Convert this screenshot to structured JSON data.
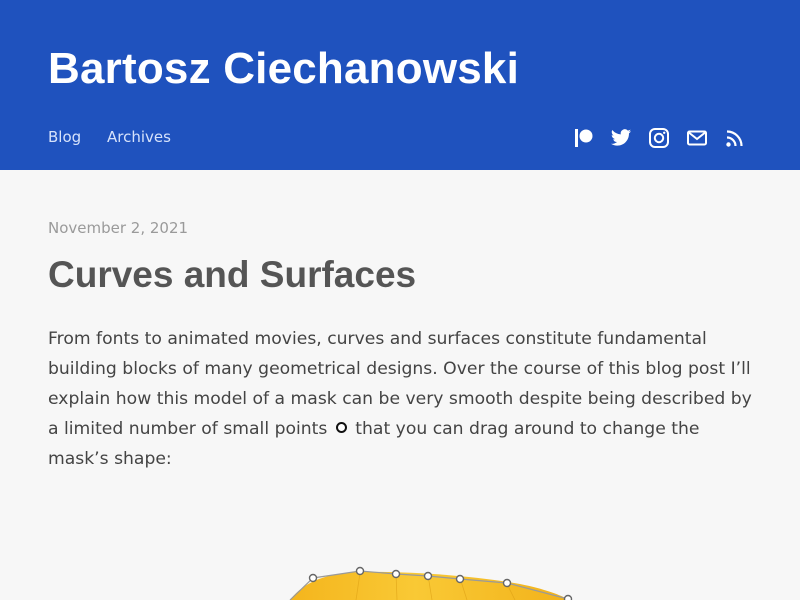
{
  "site": {
    "title": "Bartosz Ciechanowski"
  },
  "nav": {
    "items": [
      {
        "label": "Blog"
      },
      {
        "label": "Archives"
      }
    ]
  },
  "social": {
    "icons": [
      "patreon-icon",
      "twitter-icon",
      "instagram-icon",
      "mail-icon",
      "rss-icon"
    ]
  },
  "post": {
    "date": "November 2, 2021",
    "title": "Curves and Surfaces",
    "intro_before": "From fonts to animated movies, curves and surfaces constitute fundamental building blocks of many geometrical designs. Over the course of this blog post I’ll explain how this model of a mask can be very smooth despite being described by a limited number of small points",
    "intro_after": " that you can drag around to change the mask’s shape:"
  },
  "colors": {
    "header_bg": "#1f52be",
    "page_bg": "#f7f7f7",
    "mask_yellow": "#f6c22c"
  }
}
